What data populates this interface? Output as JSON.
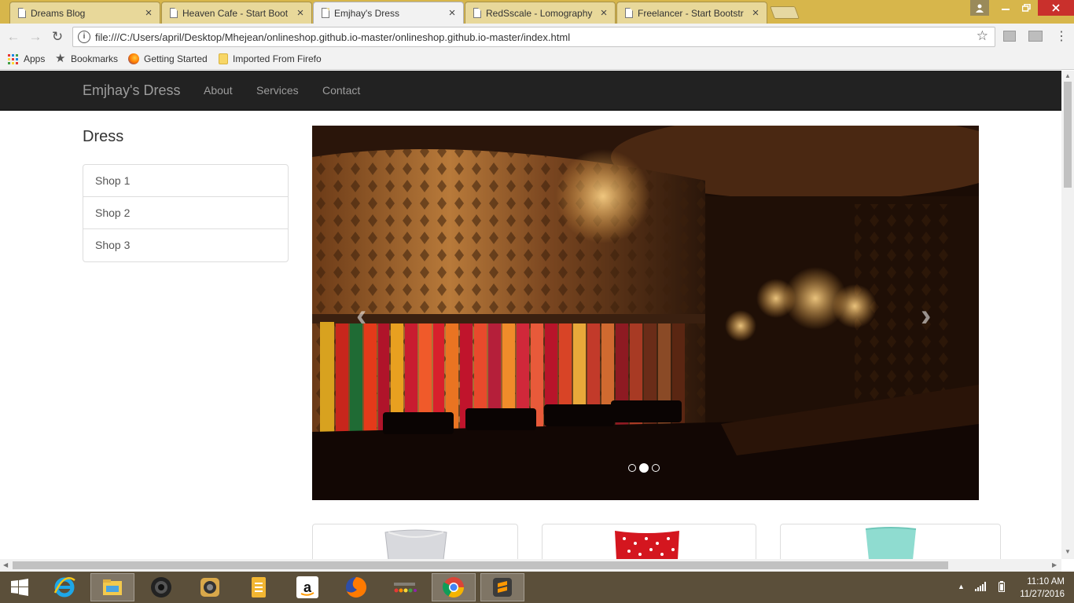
{
  "browser": {
    "tabs": [
      {
        "title": "Dreams Blog",
        "active": false
      },
      {
        "title": "Heaven Cafe - Start Boot",
        "active": false
      },
      {
        "title": "Emjhay's Dress",
        "active": true
      },
      {
        "title": "RedSscale - Lomography",
        "active": false
      },
      {
        "title": "Freelancer - Start Bootstr",
        "active": false
      }
    ],
    "tab_close": "×",
    "url": "file:///C:/Users/april/Desktop/Mhejean/onlineshop.github.io-master/onlineshop.github.io-master/index.html",
    "bookmarks": [
      {
        "label": "Apps",
        "icon": "apps-grid-icon"
      },
      {
        "label": "Bookmarks",
        "icon": "star-icon"
      },
      {
        "label": "Getting Started",
        "icon": "firefox-icon"
      },
      {
        "label": "Imported From Firefo",
        "icon": "folder-icon"
      }
    ]
  },
  "site": {
    "brand": "Emjhay's Dress",
    "nav": [
      "About",
      "Services",
      "Contact"
    ],
    "sidebar_title": "Dress",
    "shops": [
      "Shop 1",
      "Shop 2",
      "Shop 3"
    ],
    "carousel": {
      "prev": "‹",
      "next": "›",
      "slide_count": 3,
      "active_slide": 2
    }
  },
  "taskbar": {
    "time": "11:10 AM",
    "date": "11/27/2016",
    "apps": [
      "windows-start-icon",
      "internet-explorer-icon",
      "file-explorer-icon",
      "speaker-app-icon",
      "camera-app-icon",
      "documents-icon",
      "amazon-icon",
      "firefox-icon",
      "agoda-icon",
      "chrome-icon",
      "sublime-text-icon"
    ]
  },
  "colors": {
    "navbar_bg": "#222222",
    "navbar_text": "#9d9d9d",
    "tabstrip_bg": "#d7b64b",
    "taskbar_bg": "#5b4f3a"
  }
}
